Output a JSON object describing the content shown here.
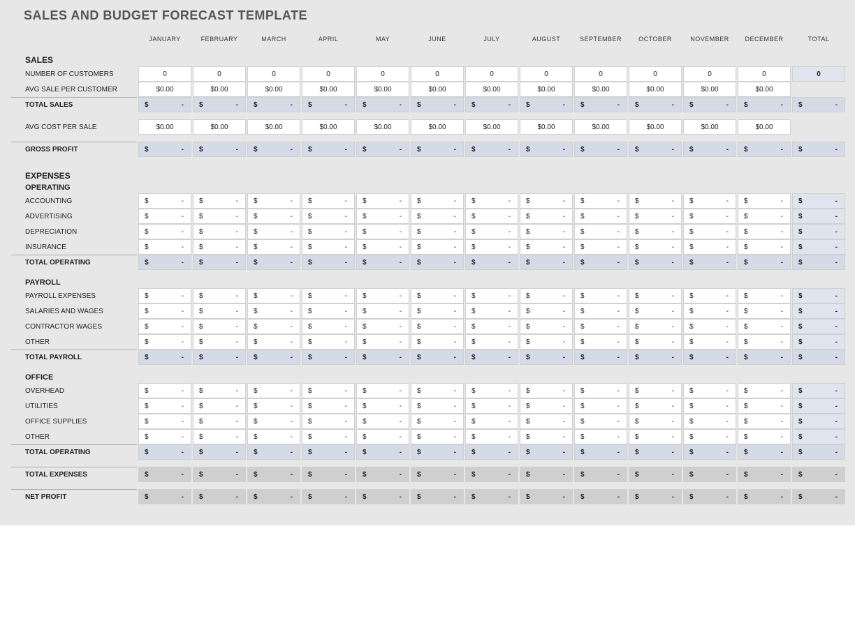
{
  "title": "SALES AND BUDGET FORECAST TEMPLATE",
  "months": [
    "JANUARY",
    "FEBRUARY",
    "MARCH",
    "APRIL",
    "MAY",
    "JUNE",
    "JULY",
    "AUGUST",
    "SEPTEMBER",
    "OCTOBER",
    "NOVEMBER",
    "DECEMBER"
  ],
  "total_label": "TOTAL",
  "sections": [
    {
      "header": "SALES",
      "rows": [
        {
          "label": "NUMBER OF CUSTOMERS",
          "type": "plain",
          "values": [
            "0",
            "0",
            "0",
            "0",
            "0",
            "0",
            "0",
            "0",
            "0",
            "0",
            "0",
            "0"
          ],
          "total": "0",
          "totalStyle": "totalcell"
        },
        {
          "label": "AVG SALE PER CUSTOMER",
          "type": "plain",
          "values": [
            "$0.00",
            "$0.00",
            "$0.00",
            "$0.00",
            "$0.00",
            "$0.00",
            "$0.00",
            "$0.00",
            "$0.00",
            "$0.00",
            "$0.00",
            "$0.00"
          ],
          "total": "",
          "totalStyle": ""
        }
      ],
      "calc": {
        "label": "TOTAL SALES",
        "values": [
          "-",
          "-",
          "-",
          "-",
          "-",
          "-",
          "-",
          "-",
          "-",
          "-",
          "-",
          "-"
        ],
        "total": "-"
      }
    },
    {
      "rows": [
        {
          "label": "AVG COST PER SALE",
          "type": "plain",
          "values": [
            "$0.00",
            "$0.00",
            "$0.00",
            "$0.00",
            "$0.00",
            "$0.00",
            "$0.00",
            "$0.00",
            "$0.00",
            "$0.00",
            "$0.00",
            "$0.00"
          ],
          "total": "",
          "totalStyle": ""
        }
      ],
      "spacerAfterRows": true,
      "calc": {
        "label": "GROSS PROFIT",
        "values": [
          "-",
          "-",
          "-",
          "-",
          "-",
          "-",
          "-",
          "-",
          "-",
          "-",
          "-",
          "-"
        ],
        "total": "-"
      }
    },
    {
      "header": "EXPENSES",
      "subheader": "OPERATING",
      "rows": [
        {
          "label": "ACCOUNTING",
          "type": "dollar",
          "values": [
            "-",
            "-",
            "-",
            "-",
            "-",
            "-",
            "-",
            "-",
            "-",
            "-",
            "-",
            "-"
          ],
          "total": "-",
          "totalStyle": "totalcell"
        },
        {
          "label": "ADVERTISING",
          "type": "dollar",
          "values": [
            "-",
            "-",
            "-",
            "-",
            "-",
            "-",
            "-",
            "-",
            "-",
            "-",
            "-",
            "-"
          ],
          "total": "-",
          "totalStyle": "totalcell"
        },
        {
          "label": "DEPRECIATION",
          "type": "dollar",
          "values": [
            "-",
            "-",
            "-",
            "-",
            "-",
            "-",
            "-",
            "-",
            "-",
            "-",
            "-",
            "-"
          ],
          "total": "-",
          "totalStyle": "totalcell"
        },
        {
          "label": "INSURANCE",
          "type": "dollar",
          "values": [
            "-",
            "-",
            "-",
            "-",
            "-",
            "-",
            "-",
            "-",
            "-",
            "-",
            "-",
            "-"
          ],
          "total": "-",
          "totalStyle": "totalcell"
        }
      ],
      "calc": {
        "label": "TOTAL OPERATING",
        "values": [
          "-",
          "-",
          "-",
          "-",
          "-",
          "-",
          "-",
          "-",
          "-",
          "-",
          "-",
          "-"
        ],
        "total": "-"
      }
    },
    {
      "subheader": "PAYROLL",
      "rows": [
        {
          "label": "PAYROLL EXPENSES",
          "type": "dollar",
          "values": [
            "-",
            "-",
            "-",
            "-",
            "-",
            "-",
            "-",
            "-",
            "-",
            "-",
            "-",
            "-"
          ],
          "total": "-",
          "totalStyle": "totalcell"
        },
        {
          "label": "SALARIES AND WAGES",
          "type": "dollar",
          "values": [
            "-",
            "-",
            "-",
            "-",
            "-",
            "-",
            "-",
            "-",
            "-",
            "-",
            "-",
            "-"
          ],
          "total": "-",
          "totalStyle": "totalcell"
        },
        {
          "label": "CONTRACTOR WAGES",
          "type": "dollar",
          "values": [
            "-",
            "-",
            "-",
            "-",
            "-",
            "-",
            "-",
            "-",
            "-",
            "-",
            "-",
            "-"
          ],
          "total": "-",
          "totalStyle": "totalcell"
        },
        {
          "label": "OTHER",
          "type": "dollar",
          "values": [
            "-",
            "-",
            "-",
            "-",
            "-",
            "-",
            "-",
            "-",
            "-",
            "-",
            "-",
            "-"
          ],
          "total": "-",
          "totalStyle": "totalcell"
        }
      ],
      "calc": {
        "label": "TOTAL PAYROLL",
        "values": [
          "-",
          "-",
          "-",
          "-",
          "-",
          "-",
          "-",
          "-",
          "-",
          "-",
          "-",
          "-"
        ],
        "total": "-"
      }
    },
    {
      "subheader": "OFFICE",
      "rows": [
        {
          "label": "OVERHEAD",
          "type": "dollar",
          "values": [
            "-",
            "-",
            "-",
            "-",
            "-",
            "-",
            "-",
            "-",
            "-",
            "-",
            "-",
            "-"
          ],
          "total": "-",
          "totalStyle": "totalcell"
        },
        {
          "label": "UTILITIES",
          "type": "dollar",
          "values": [
            "-",
            "-",
            "-",
            "-",
            "-",
            "-",
            "-",
            "-",
            "-",
            "-",
            "-",
            "-"
          ],
          "total": "-",
          "totalStyle": "totalcell"
        },
        {
          "label": "OFFICE SUPPLIES",
          "type": "dollar",
          "values": [
            "-",
            "-",
            "-",
            "-",
            "-",
            "-",
            "-",
            "-",
            "-",
            "-",
            "-",
            "-"
          ],
          "total": "-",
          "totalStyle": "totalcell"
        },
        {
          "label": "OTHER",
          "type": "dollar",
          "values": [
            "-",
            "-",
            "-",
            "-",
            "-",
            "-",
            "-",
            "-",
            "-",
            "-",
            "-",
            "-"
          ],
          "total": "-",
          "totalStyle": "totalcell"
        }
      ],
      "calc": {
        "label": "TOTAL OPERATING",
        "values": [
          "-",
          "-",
          "-",
          "-",
          "-",
          "-",
          "-",
          "-",
          "-",
          "-",
          "-",
          "-"
        ],
        "total": "-"
      }
    }
  ],
  "summaries": [
    {
      "label": "TOTAL EXPENSES",
      "values": [
        "-",
        "-",
        "-",
        "-",
        "-",
        "-",
        "-",
        "-",
        "-",
        "-",
        "-",
        "-"
      ],
      "total": "-"
    },
    {
      "label": "NET PROFIT",
      "values": [
        "-",
        "-",
        "-",
        "-",
        "-",
        "-",
        "-",
        "-",
        "-",
        "-",
        "-",
        "-"
      ],
      "total": "-"
    }
  ]
}
